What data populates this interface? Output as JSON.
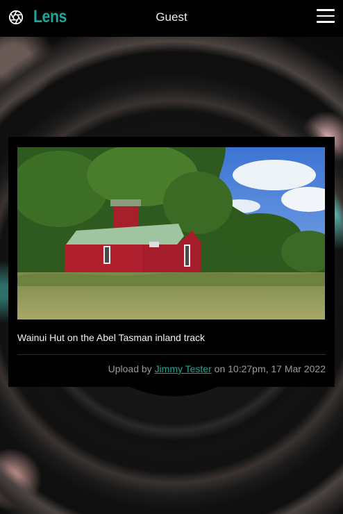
{
  "navbar": {
    "brand": "Lens",
    "user_label": "Guest",
    "logo_icon": "aperture-icon",
    "menu_icon": "hamburger-menu-icon"
  },
  "post": {
    "caption": "Wainui Hut on the Abel Tasman inland track",
    "upload_prefix": "Upload by",
    "author": "Jimmy Tester",
    "upload_on": "on",
    "timestamp": "10:27pm, 17 Mar 2022"
  },
  "colors": {
    "accent": "#1aa89a",
    "navbar_bg": "#000000",
    "card_bg": "#000000"
  }
}
